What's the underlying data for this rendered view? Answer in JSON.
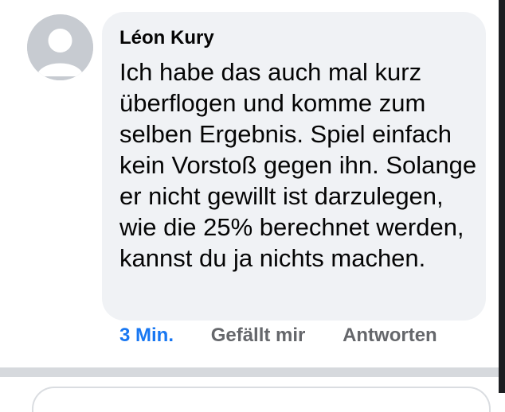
{
  "comment": {
    "author": "Léon Kury",
    "text": "Ich habe das auch mal kurz überflogen und komme zum selben Ergebnis. Spiel einfach kein Vorstoß gegen ihn. Solange er nicht gewillt ist darzulegen, wie die 25% berechnet werden, kannst du ja nichts machen.",
    "avatar_icon": "default-user-icon",
    "actions": {
      "time": "3 Min.",
      "like": "Gefällt mir",
      "reply": "Antworten"
    }
  },
  "colors": {
    "bubble": "#f0f2f5",
    "link_blue": "#1877f2",
    "action_gray": "#65676b",
    "avatar": "#c7cbd1",
    "separator": "#d6d9dd"
  }
}
